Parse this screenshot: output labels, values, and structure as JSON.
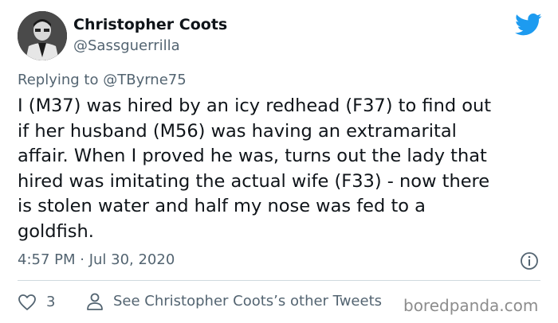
{
  "author": {
    "name": "Christopher Coots",
    "handle": "@Sassguerrilla"
  },
  "reply": {
    "prefix": "Replying to",
    "mention": "@TByrne75"
  },
  "tweet": {
    "lines": [
      "I (M37) was hired by an icy redhead (F37) to find out",
      "if her husband (M56) was having an extramarital",
      "affair. When I proved he was, turns out the lady that",
      "hired was imitating the actual wife (F33) - now there",
      "is stolen water and half my nose was fed to a",
      "goldfish."
    ],
    "timestamp": "4:57 PM · Jul 30, 2020"
  },
  "actions": {
    "like_count": "3",
    "see_other": "See Christopher Coots’s other Tweets"
  },
  "watermark": "boredpanda.com",
  "icons": {
    "brand": "twitter-bird-icon",
    "info": "info-icon",
    "like": "heart-icon",
    "profile": "person-icon"
  },
  "colors": {
    "twitter_blue": "#1d9bf0",
    "text_primary": "#0f1419",
    "text_secondary": "#536471",
    "divider": "#cfd9de"
  }
}
